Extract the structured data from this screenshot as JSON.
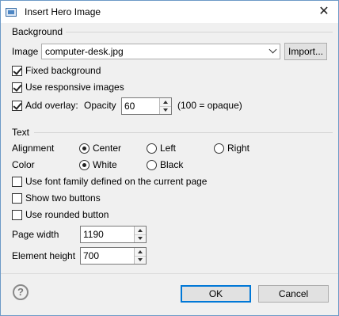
{
  "window": {
    "title": "Insert Hero Image",
    "close": "✕"
  },
  "background": {
    "group_label": "Background",
    "image_label": "Image",
    "image_value": "computer-desk.jpg",
    "import_label": "Import...",
    "fixed_label": "Fixed background",
    "responsive_label": "Use responsive images",
    "overlay_label": "Add overlay:",
    "opacity_label": "Opacity",
    "opacity_value": "60",
    "opacity_hint": "(100 = opaque)"
  },
  "text": {
    "group_label": "Text",
    "alignment_label": "Alignment",
    "align_center": "Center",
    "align_left": "Left",
    "align_right": "Right",
    "color_label": "Color",
    "color_white": "White",
    "color_black": "Black",
    "font_family_label": "Use font family defined on the current page",
    "two_buttons_label": "Show two buttons",
    "rounded_label": "Use rounded button",
    "page_width_label": "Page width",
    "page_width_value": "1190",
    "element_height_label": "Element height",
    "element_height_value": "700"
  },
  "footer": {
    "ok": "OK",
    "cancel": "Cancel",
    "help": "?"
  },
  "state": {
    "fixed_background": true,
    "responsive_images": true,
    "add_overlay": true,
    "alignment": "Center",
    "color": "White",
    "use_font_family": false,
    "show_two_buttons": false,
    "rounded_button": false
  }
}
